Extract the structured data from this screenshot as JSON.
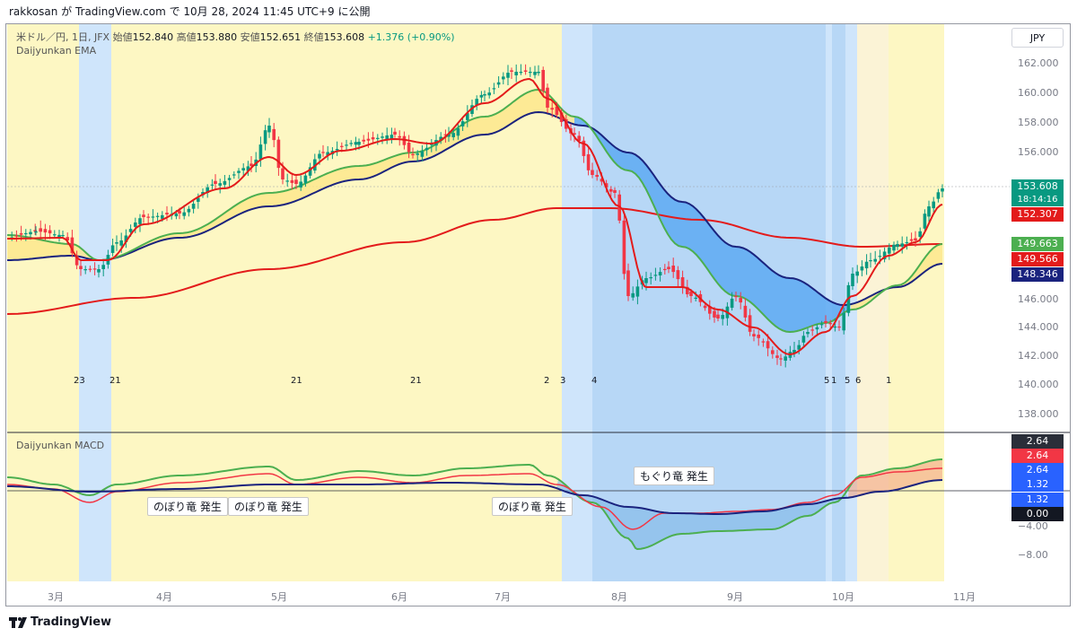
{
  "header": {
    "attribution": "rakkosan が TradingView.com で 10月 28, 2024 11:45 UTC+9 に公開"
  },
  "legend": {
    "symbol": "米ドル／円, 1日, JFX",
    "open_label": "始値",
    "open": "152.840",
    "high_label": "高値",
    "high": "153.880",
    "low_label": "安値",
    "low": "152.651",
    "close_label": "終値",
    "close": "153.608",
    "change": "+1.376 (+0.90%)",
    "indicator": "Daijyunkan EMA"
  },
  "currency_button": "JPY",
  "price_axis": {
    "ticks": [
      "162.000",
      "160.000",
      "158.000",
      "156.000",
      "146.000",
      "144.000",
      "142.000",
      "140.000",
      "138.000"
    ]
  },
  "price_labels": {
    "last": "153.608",
    "countdown": "18:14:16",
    "ema_short": "152.307",
    "ema_mid": "149.663",
    "ema_long_red": "149.566",
    "ema_long_blue": "148.346"
  },
  "macd": {
    "title": "Daijyunkan MACD",
    "labels": [
      "2.64",
      "2.64",
      "2.64",
      "1.32",
      "1.32",
      "0.00"
    ],
    "ticks": [
      "−4.00",
      "−8.00"
    ],
    "annotations": [
      "のぼり竜 発生",
      "のぼり竜 発生",
      "のぼり竜 発生",
      "もぐり竜 発生"
    ]
  },
  "cycle_counts": [
    "23",
    "21",
    "21",
    "21",
    "2",
    "3",
    "4",
    "5",
    "1",
    "5",
    "6",
    "1"
  ],
  "time_axis": [
    "3月",
    "4月",
    "5月",
    "6月",
    "7月",
    "8月",
    "9月",
    "10月",
    "11月"
  ],
  "footer": {
    "brand": "TradingView"
  },
  "colors": {
    "bullish": "#089981",
    "bearish": "#f23645",
    "ema_short": "#e31b1b",
    "ema_mid": "#4caf50",
    "ema_long": "#1a237e",
    "ema_200": "#e31b1b",
    "bg_yellow": "#fdf7c3",
    "bg_lightblue": "#cfe5fb",
    "bg_blue": "#b7d7f6",
    "fill_blue": "#5eaaf2",
    "fill_yellow": "#fce68a"
  }
}
